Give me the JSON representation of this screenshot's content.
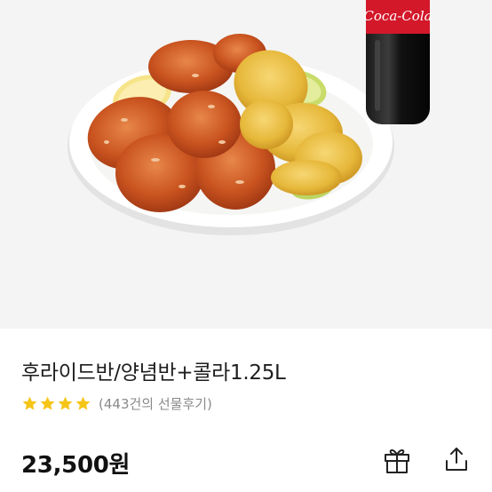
{
  "product": {
    "bottle_brand": "Coca-Cola",
    "title": "후라이드반/양념반+콜라1.25L",
    "rating": {
      "stars": 4,
      "max": 4,
      "star_color": "#f5c518"
    },
    "review_text": "(443건의 선물후기)",
    "price": "23,500원"
  },
  "actions": {
    "gift_icon": "gift-icon",
    "share_icon": "share-icon"
  },
  "colors": {
    "hero_background": "#f4f4f4",
    "price": "#111111",
    "review": "#8a8a8a"
  }
}
